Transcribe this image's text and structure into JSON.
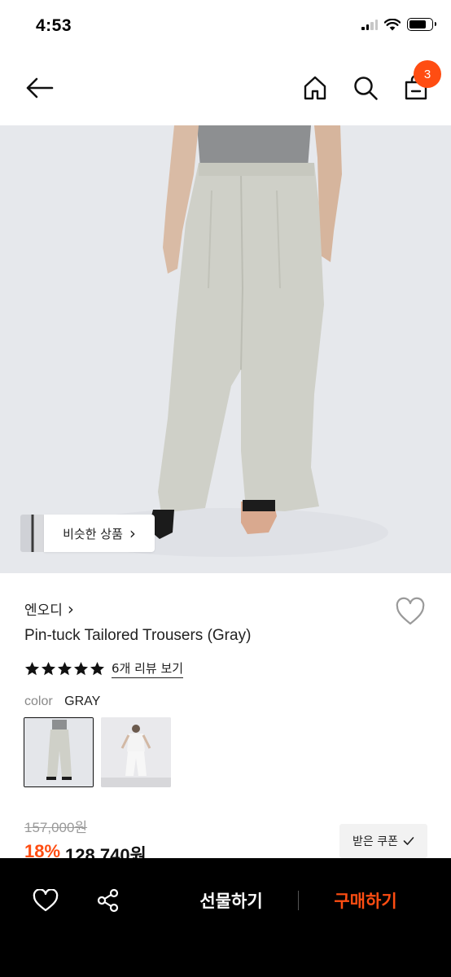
{
  "status_bar": {
    "time": "4:53",
    "icons": [
      "cellular-signal-icon",
      "wifi-icon",
      "battery-icon"
    ]
  },
  "header": {
    "icons": [
      "back-arrow-icon",
      "home-icon",
      "search-icon",
      "cart-icon"
    ],
    "cart_count": "3"
  },
  "colors": {
    "accent": "#ff4d12",
    "bottom_bar": "#000000",
    "image_background": "#e6e8ec"
  },
  "similar_products": {
    "label": "비슷한 상품",
    "chevron": "›"
  },
  "product": {
    "brand": "엔오디",
    "brand_chevron": "›",
    "title": "Pin-tuck Tailored Trousers (Gray)",
    "rating_stars": 5,
    "review_link": "6개 리뷰 보기",
    "color_label": "color",
    "color_value": "GRAY",
    "swatches": [
      "gray-trousers-swatch",
      "white-outfit-swatch"
    ],
    "selected_swatch": 0,
    "original_price": "157,000원",
    "discount": "18%",
    "price": "128,740원",
    "coupon_label": "받은 쿠폰",
    "coupon_icon": "checkmark-icon"
  },
  "bottom_bar": {
    "gift_label": "선물하기",
    "buy_label": "구매하기",
    "icons": [
      "heart-icon",
      "share-icon"
    ]
  }
}
